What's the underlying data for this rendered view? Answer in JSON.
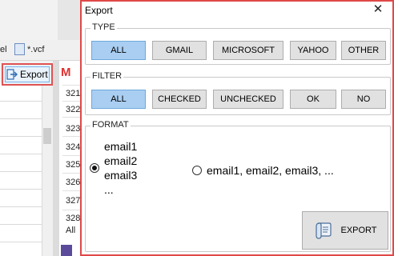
{
  "background": {
    "toolbar_left_text": "el",
    "vcf_label": "*.vcf",
    "export_label": "Export",
    "row_numbers": [
      "321",
      "322",
      "323",
      "324",
      "325",
      "326",
      "327",
      "328"
    ],
    "all_label": "All"
  },
  "dialog": {
    "title": "Export",
    "close_glyph": "✕",
    "type": {
      "label": "TYPE",
      "options": [
        {
          "label": "ALL",
          "selected": true
        },
        {
          "label": "GMAIL",
          "selected": false
        },
        {
          "label": "MICROSOFT",
          "selected": false
        },
        {
          "label": "YAHOO",
          "selected": false
        },
        {
          "label": "OTHER",
          "selected": false
        }
      ]
    },
    "filter": {
      "label": "FILTER",
      "options": [
        {
          "label": "ALL",
          "selected": true
        },
        {
          "label": "CHECKED",
          "selected": false
        },
        {
          "label": "UNCHECKED",
          "selected": false
        },
        {
          "label": "OK",
          "selected": false
        },
        {
          "label": "NO",
          "selected": false
        }
      ]
    },
    "format": {
      "label": "FORMAT",
      "list_option": [
        "email1",
        "email2",
        "email3",
        "..."
      ],
      "inline_option": "email1, email2, email3, ...",
      "selected": "list"
    },
    "export_button": "EXPORT"
  },
  "colors": {
    "accent_border": "#e04848",
    "selected_bg": "#a9cef2"
  }
}
